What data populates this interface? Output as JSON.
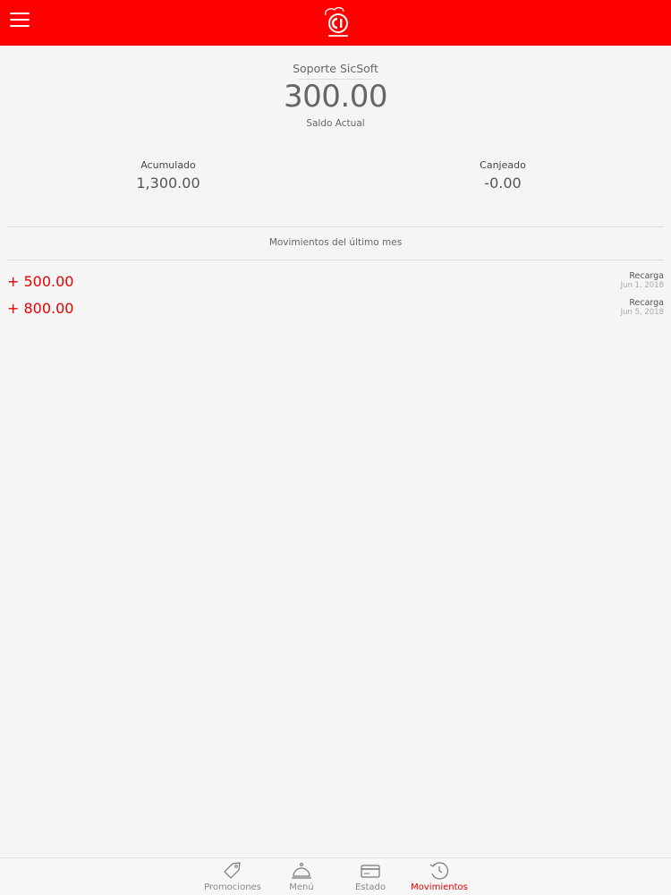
{
  "header": {
    "user_name": "Soporte SicSoft",
    "balance": "300.00",
    "balance_label": "Saldo Actual"
  },
  "stats": {
    "accumulated_label": "Acumulado",
    "accumulated_value": "1,300.00",
    "redeemed_label": "Canjeado",
    "redeemed_value": "-0.00"
  },
  "movements": {
    "title": "Movimientos del último mes",
    "items": [
      {
        "amount": "+ 500.00",
        "type": "Recarga",
        "date": "Jun 1, 2018"
      },
      {
        "amount": "+ 800.00",
        "type": "Recarga",
        "date": "Jun 5, 2018"
      }
    ]
  },
  "tabs": [
    {
      "label": "Promociones",
      "icon": "tag-icon"
    },
    {
      "label": "Menú",
      "icon": "cloche-icon"
    },
    {
      "label": "Estado",
      "icon": "card-icon"
    },
    {
      "label": "Movimientos",
      "icon": "history-icon",
      "active": true
    }
  ],
  "colors": {
    "brand": "#fe0000",
    "accent": "#e60000"
  }
}
